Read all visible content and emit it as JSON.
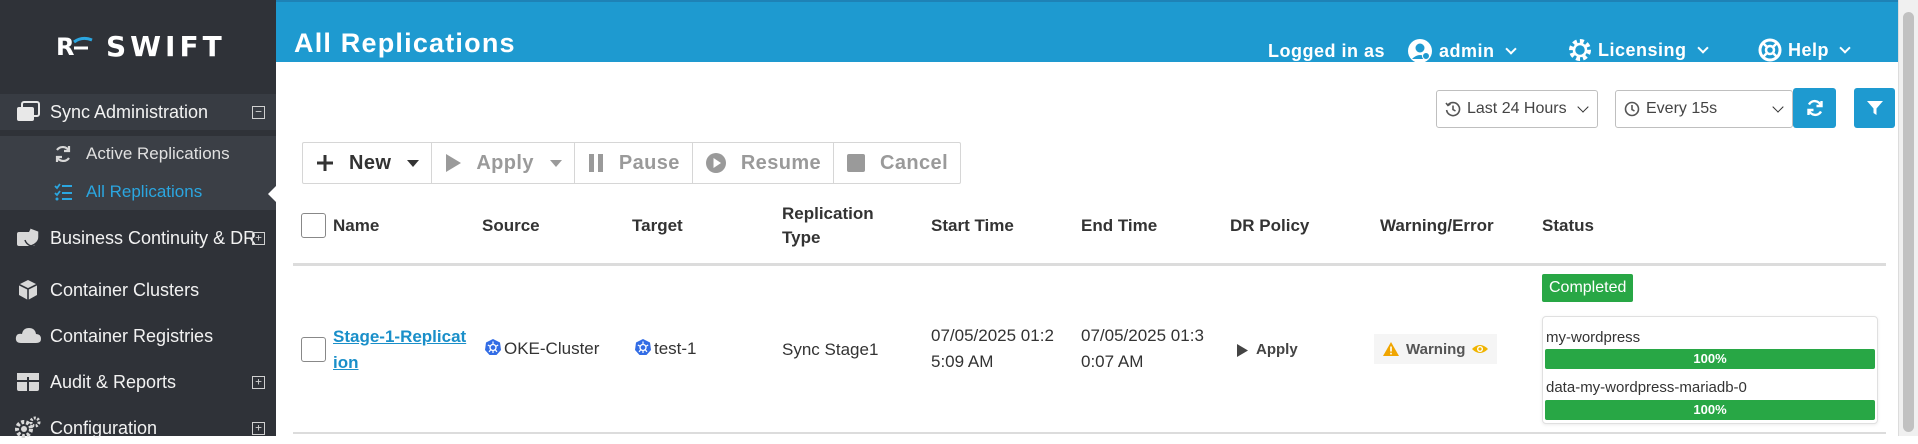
{
  "app": {
    "logo_text": "SWIFT"
  },
  "sidebar": {
    "items": [
      {
        "label": "Sync Administration",
        "expand": "−"
      },
      {
        "label": "Business Continuity & DR",
        "expand": "+"
      },
      {
        "label": "Container Clusters"
      },
      {
        "label": "Container Registries"
      },
      {
        "label": "Audit & Reports",
        "expand": "+"
      },
      {
        "label": "Configuration",
        "expand": "+"
      }
    ],
    "sub_items": [
      {
        "label": "Active Replications"
      },
      {
        "label": "All Replications"
      }
    ]
  },
  "header": {
    "title": "All Replications",
    "logged_in_label": "Logged in as",
    "user": "admin",
    "licensing": "Licensing",
    "help": "Help"
  },
  "filters": {
    "time_range": "Last 24 Hours",
    "refresh_interval": "Every 15s"
  },
  "toolbar": {
    "new": "New",
    "apply": "Apply",
    "pause": "Pause",
    "resume": "Resume",
    "cancel": "Cancel"
  },
  "table": {
    "columns": {
      "name": "Name",
      "source": "Source",
      "target": "Target",
      "type_line1": "Replication",
      "type_line2": "Type",
      "start": "Start Time",
      "end": "End Time",
      "dr_policy": "DR Policy",
      "warning": "Warning/Error",
      "status": "Status"
    },
    "rows": [
      {
        "name_line1": "Stage-1-Replicat",
        "name_line2": "ion",
        "source": "OKE-Cluster",
        "target": "test-1",
        "type": "Sync Stage1",
        "start_line1": "07/05/2025 01:2",
        "start_line2": "5:09 AM",
        "end_line1": "07/05/2025 01:3",
        "end_line2": "0:07 AM",
        "dr_policy": "Apply",
        "warning": "Warning",
        "status": "Completed",
        "pvcs": [
          {
            "name": "my-wordpress",
            "progress": "100%"
          },
          {
            "name": "data-my-wordpress-mariadb-0",
            "progress": "100%"
          }
        ]
      }
    ]
  },
  "colors": {
    "header": "#1e9ad0",
    "sidebar": "#2f3238",
    "success": "#28a745",
    "link": "#1a8fc9",
    "active_sub": "#2ba6e0"
  }
}
